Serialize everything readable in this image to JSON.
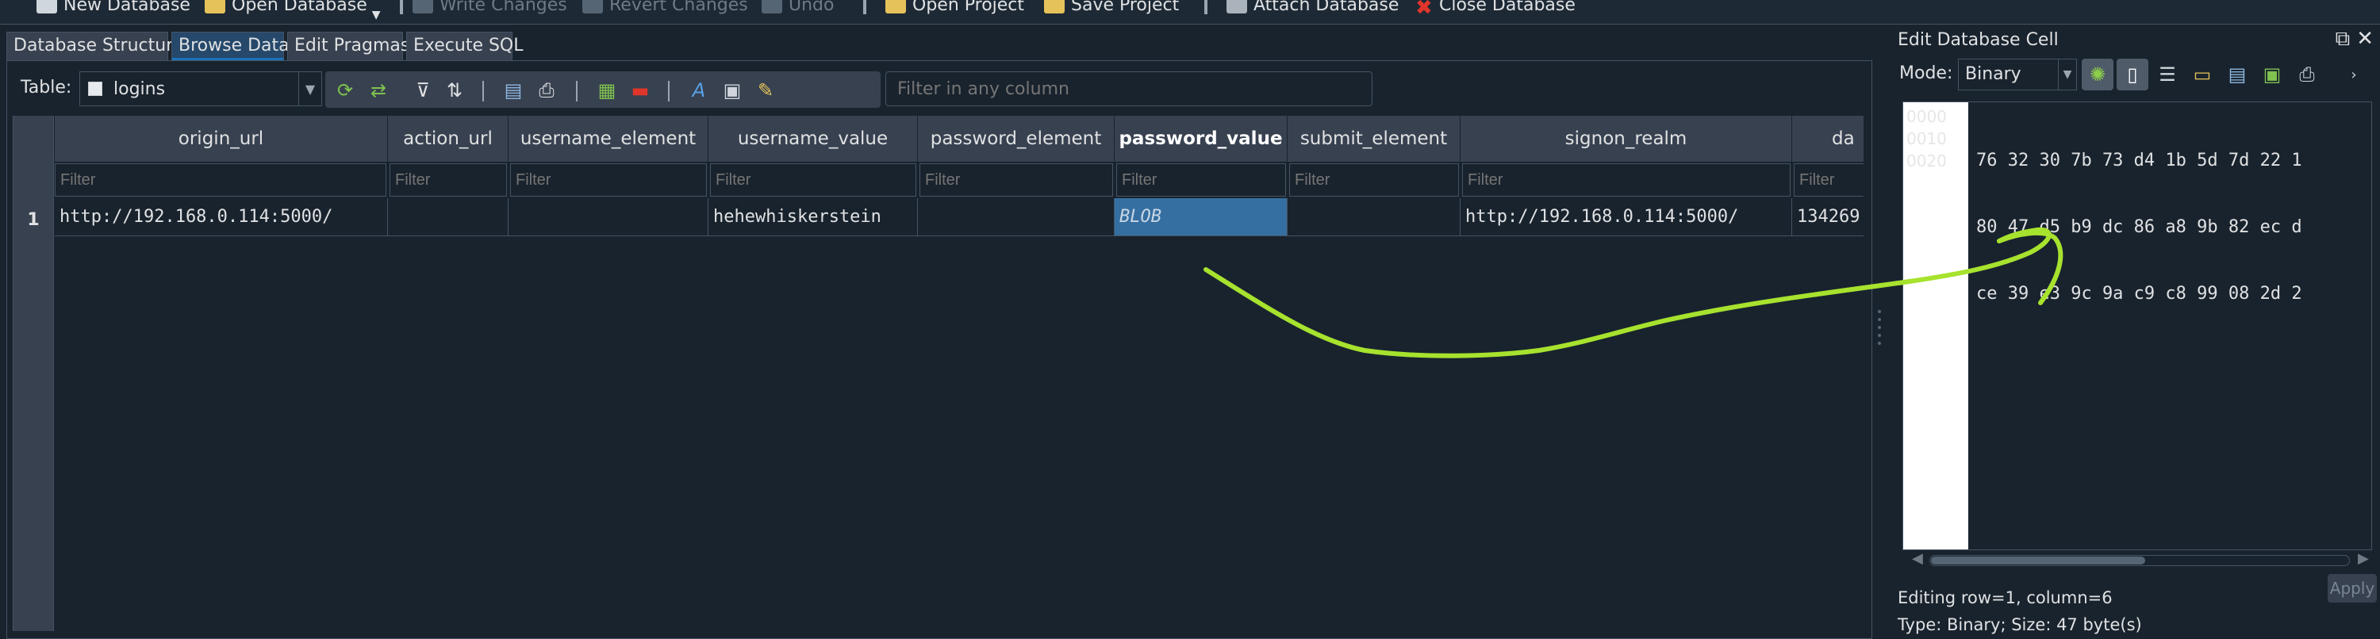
{
  "toolbar": {
    "items": [
      {
        "label": "New Database",
        "enabled": true
      },
      {
        "label": "Open Database",
        "enabled": true
      },
      {
        "label": "Write Changes",
        "enabled": false
      },
      {
        "label": "Revert Changes",
        "enabled": false
      },
      {
        "label": "Undo",
        "enabled": false
      },
      {
        "label": "Open Project",
        "enabled": true
      },
      {
        "label": "Save Project",
        "enabled": true
      },
      {
        "label": "Attach Database",
        "enabled": true
      },
      {
        "label": "Close Database",
        "enabled": true
      }
    ]
  },
  "tabs": [
    {
      "label": "Database Structure",
      "active": false
    },
    {
      "label": "Browse Data",
      "active": true
    },
    {
      "label": "Edit Pragmas",
      "active": false
    },
    {
      "label": "Execute SQL",
      "active": false
    }
  ],
  "browse": {
    "table_label": "Table:",
    "table_value": "logins",
    "filter_all_placeholder": "Filter in any column",
    "filter_placeholder": "Filter",
    "columns": [
      "origin_url",
      "action_url",
      "username_element",
      "username_value",
      "password_element",
      "password_value",
      "submit_element",
      "signon_realm",
      "da"
    ],
    "row_number": "1",
    "row": [
      "http://192.168.0.114:5000/",
      "",
      "",
      "hehewhiskerstein",
      "",
      "BLOB",
      "",
      "http://192.168.0.114:5000/",
      "134269"
    ]
  },
  "edit_cell": {
    "title": "Edit Database Cell",
    "mode_label": "Mode:",
    "mode_value": "Binary",
    "offsets": [
      "0000",
      "0010",
      "0020"
    ],
    "hex_lines": [
      "76 32 30 7b 73 d4 1b 5d 7d 22 1",
      "80 47 d5 b9 dc 86 a8 9b 82 ec d",
      "ce 39 e3 9c 9a c9 c8 99 08 2d 2"
    ],
    "status_position": "Editing row=1, column=6",
    "status_type": "Type: Binary; Size: 47 byte(s)",
    "apply_label": "Apply"
  },
  "colors": {
    "background": "#19232d",
    "header": "#37414f",
    "selection": "#356fa2",
    "annotation": "#a6e22e"
  }
}
